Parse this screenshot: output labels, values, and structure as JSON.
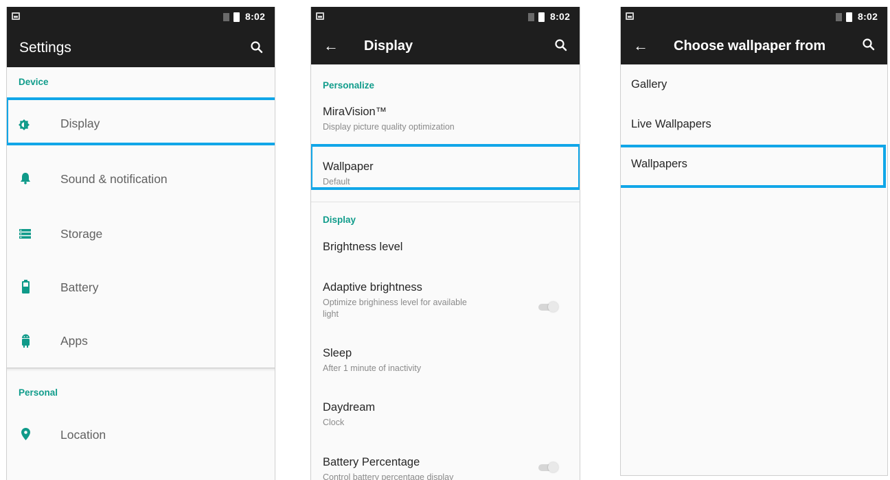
{
  "status": {
    "time": "8:02"
  },
  "settings": {
    "title": "Settings",
    "section_device": "Device",
    "items": [
      {
        "label": "Display",
        "icon": "brightness-icon"
      },
      {
        "label": "Sound & notification",
        "icon": "bell-icon"
      },
      {
        "label": "Storage",
        "icon": "storage-icon"
      },
      {
        "label": "Battery",
        "icon": "battery-icon"
      },
      {
        "label": "Apps",
        "icon": "android-icon"
      }
    ],
    "section_personal": "Personal",
    "personal_items": [
      {
        "label": "Location",
        "icon": "location-pin-icon"
      }
    ]
  },
  "display": {
    "title": "Display",
    "section_personalize": "Personalize",
    "miravision_title": "MiraVision™",
    "miravision_sub": "Display picture quality optimization",
    "wallpaper_title": "Wallpaper",
    "wallpaper_sub": "Default",
    "section_display": "Display",
    "brightness_title": "Brightness level",
    "adaptive_title": "Adaptive brightness",
    "adaptive_sub_1": "Optimize brighiness level for available",
    "adaptive_sub_2": "light",
    "sleep_title": "Sleep",
    "sleep_sub": "After 1 minute of inactivity",
    "daydream_title": "Daydream",
    "daydream_sub": "Clock",
    "battery_pct_title": "Battery Percentage",
    "battery_pct_sub": "Control battery percentage display"
  },
  "wallpaper": {
    "title": "Choose wallpaper from",
    "options": [
      "Gallery",
      "Live Wallpapers",
      "Wallpapers"
    ]
  },
  "colors": {
    "accent": "#109c8b",
    "highlight": "#11a6e8",
    "toolbar": "#1e1e1e"
  }
}
